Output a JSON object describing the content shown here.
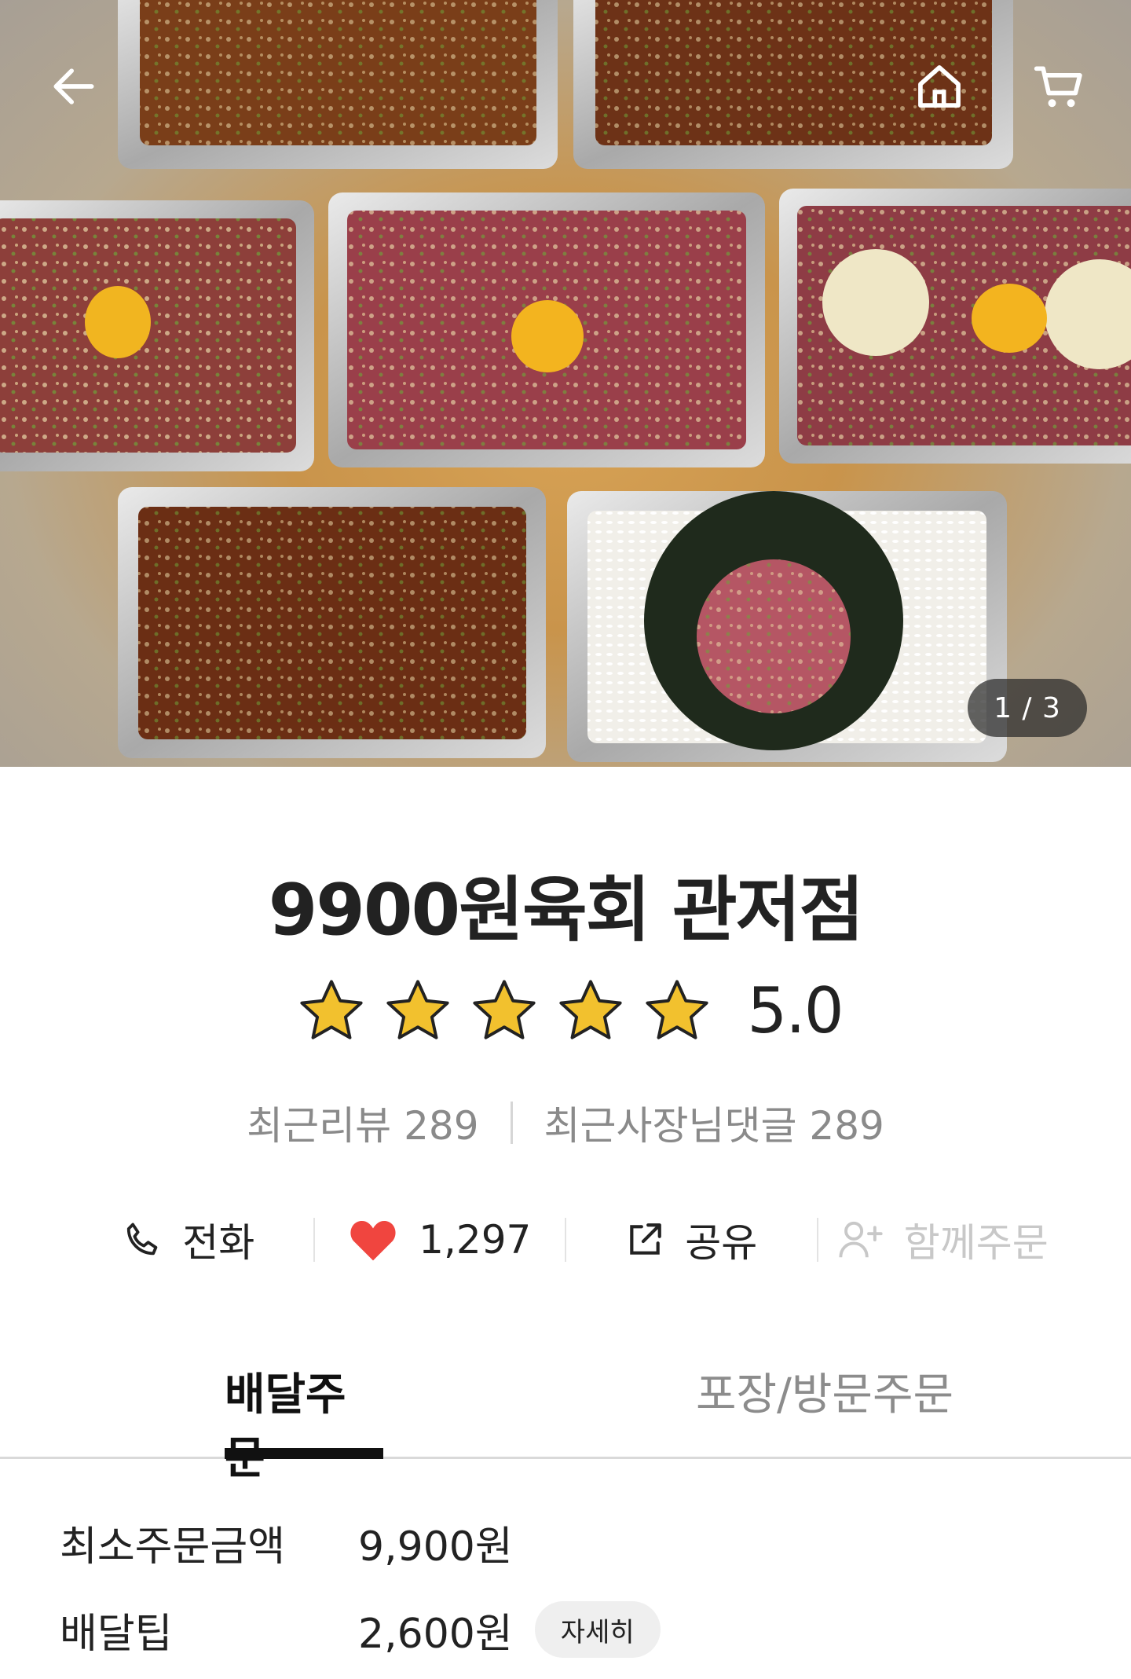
{
  "hero": {
    "image_counter": "1 / 3",
    "icons": {
      "back": "arrow-left-icon",
      "home": "home-icon",
      "cart": "cart-icon"
    }
  },
  "store": {
    "name": "9900원육회 관저점",
    "rating": "5.0",
    "rating_stars": 5,
    "recent_reviews": "최근리뷰 289",
    "recent_owner_replies": "최근사장님댓글 289"
  },
  "actions": {
    "call_label": "전화",
    "like_count": "1,297",
    "share_label": "공유",
    "group_order_label": "함께주문"
  },
  "tabs": [
    {
      "label": "배달주문",
      "active": true
    },
    {
      "label": "포장/방문주문",
      "active": false
    }
  ],
  "order_info": {
    "min_order_label": "최소주문금액",
    "min_order_value": "9,900원",
    "delivery_tip_label": "배달팁",
    "delivery_tip_value": "2,600원",
    "detail_button": "자세히"
  },
  "colors": {
    "star": "#f2c12e",
    "heart": "#f0453f",
    "active_tab": "#111111",
    "inactive": "#8c8c8c"
  }
}
